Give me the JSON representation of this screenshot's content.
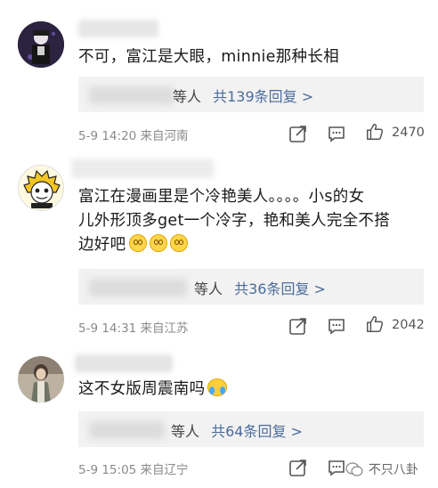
{
  "comments": [
    {
      "text": "不可，富江是大眼，minnie那种长相",
      "reply_suffix": "等人",
      "reply_link": "共139条回复 >",
      "meta": "5-9 14:20 来自河南",
      "likes": "2470"
    },
    {
      "text_lines": [
        "富江在漫画里是个冷艳美人。。。。小s的女",
        "儿外形顶多get一个冷字，艳和美人完全不搭",
        "边好吧"
      ],
      "reply_suffix": "等人",
      "reply_link": "共36条回复 >",
      "meta": "5-9 14:31 来自江苏",
      "likes": "2042"
    },
    {
      "text": "这不女版周震南吗",
      "reply_suffix": "等人",
      "reply_link": "共64条回复 >",
      "meta": "5-9 15:05 来自辽宁",
      "likes": ""
    }
  ],
  "watermark": "不只八卦",
  "icons": {
    "share": "share-icon",
    "comment": "comment-icon",
    "like": "thumbs-up-icon"
  },
  "colors": {
    "link": "#4b6c9b",
    "meta": "#8a8a8a",
    "reply_bg": "#f2f2f2"
  }
}
